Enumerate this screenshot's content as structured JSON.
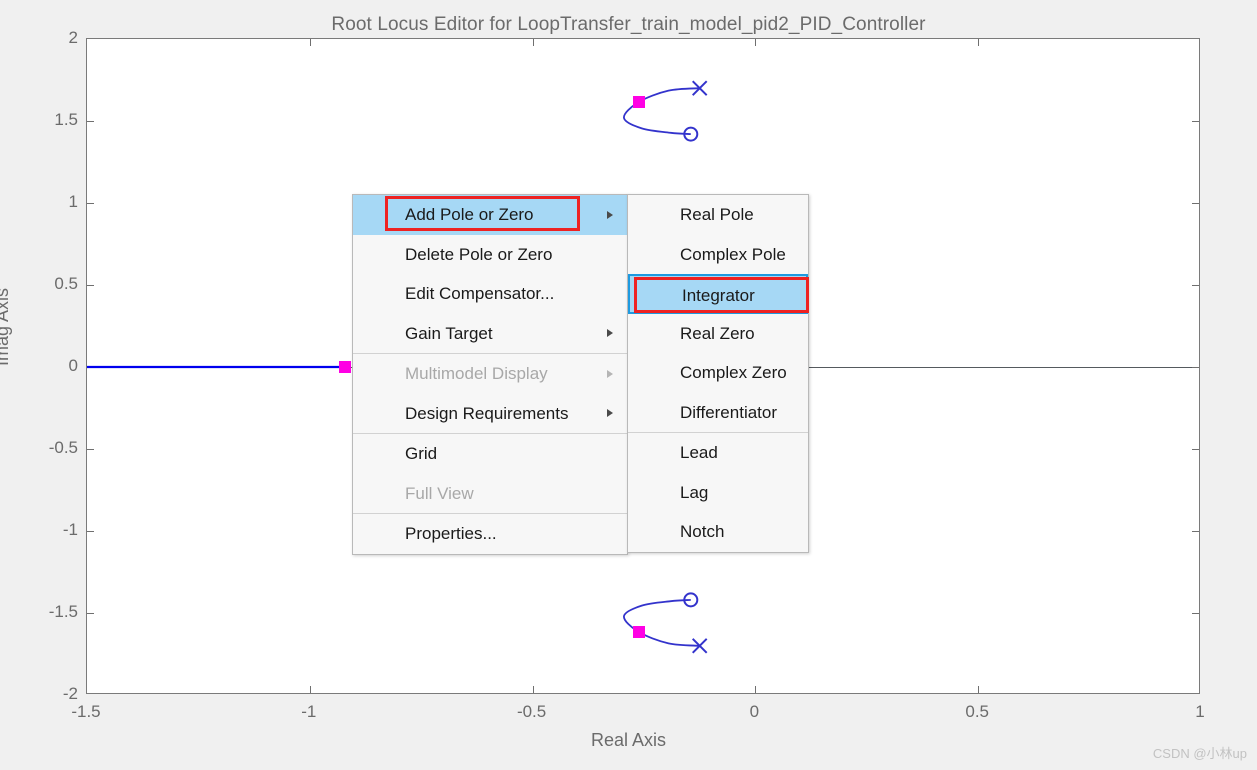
{
  "title": "Root Locus Editor for LoopTransfer_train_model_pid2_PID_Controller",
  "axes": {
    "xlabel": "Real Axis",
    "ylabel": "Imag Axis",
    "xticks": [
      "-1.5",
      "-1",
      "-0.5",
      "0",
      "0.5",
      "1"
    ],
    "yticks": [
      "2",
      "1.5",
      "1",
      "0.5",
      "0",
      "-0.5",
      "-1",
      "-1.5",
      "-2"
    ],
    "xlim": [
      -1.5,
      1
    ],
    "ylim": [
      -2,
      2
    ]
  },
  "chart_data": {
    "type": "scatter",
    "title": "Root Locus Editor for LoopTransfer_train_model_pid2_PID_Controller",
    "xlabel": "Real Axis",
    "ylabel": "Imag Axis",
    "xlim": [
      -1.5,
      1
    ],
    "ylim": [
      -2,
      2
    ],
    "grid": false,
    "legend": "none",
    "series": [
      {
        "name": "open-loop poles",
        "marker": "x",
        "color": "#3333cc",
        "points": [
          [
            -0.125,
            1.7
          ],
          [
            -0.125,
            -1.7
          ]
        ]
      },
      {
        "name": "open-loop zeros",
        "marker": "o",
        "color": "#3333cc",
        "points": [
          [
            -0.145,
            1.42
          ],
          [
            -0.145,
            -1.42
          ]
        ]
      },
      {
        "name": "closed-loop gain locations",
        "marker": "square",
        "color": "#ff00e4",
        "points": [
          [
            -0.262,
            1.615
          ],
          [
            -0.262,
            -1.615
          ],
          [
            -0.92,
            0.0
          ]
        ]
      },
      {
        "name": "locus branch upper",
        "marker": "line",
        "color": "#3333cc",
        "points": [
          [
            -0.125,
            1.7
          ],
          [
            -0.195,
            1.685
          ],
          [
            -0.262,
            1.615
          ],
          [
            -0.295,
            1.52
          ],
          [
            -0.255,
            1.455
          ],
          [
            -0.19,
            1.428
          ],
          [
            -0.145,
            1.42
          ]
        ]
      },
      {
        "name": "locus branch lower",
        "marker": "line",
        "color": "#3333cc",
        "points": [
          [
            -0.125,
            -1.7
          ],
          [
            -0.195,
            -1.685
          ],
          [
            -0.262,
            -1.615
          ],
          [
            -0.295,
            -1.52
          ],
          [
            -0.255,
            -1.455
          ],
          [
            -0.19,
            -1.428
          ],
          [
            -0.145,
            -1.42
          ]
        ]
      },
      {
        "name": "locus branch real axis",
        "marker": "line",
        "color": "#0000ee",
        "points": [
          [
            -1.5,
            0.0
          ],
          [
            -0.92,
            0.0
          ]
        ]
      }
    ]
  },
  "context_menu": {
    "items": [
      {
        "label": "Add Pole or Zero",
        "disabled": false,
        "submenu": true,
        "highlighted": true,
        "separator_before": false
      },
      {
        "label": "Delete Pole or Zero",
        "disabled": false,
        "submenu": false,
        "highlighted": false,
        "separator_before": false
      },
      {
        "label": "Edit Compensator...",
        "disabled": false,
        "submenu": false,
        "highlighted": false,
        "separator_before": false
      },
      {
        "label": "Gain Target",
        "disabled": false,
        "submenu": true,
        "highlighted": false,
        "separator_before": false
      },
      {
        "label": "Multimodel Display",
        "disabled": true,
        "submenu": true,
        "highlighted": false,
        "separator_before": true
      },
      {
        "label": "Design Requirements",
        "disabled": false,
        "submenu": true,
        "highlighted": false,
        "separator_before": false
      },
      {
        "label": "Grid",
        "disabled": false,
        "submenu": false,
        "highlighted": false,
        "separator_before": true
      },
      {
        "label": "Full View",
        "disabled": true,
        "submenu": false,
        "highlighted": false,
        "separator_before": false
      },
      {
        "label": "Properties...",
        "disabled": false,
        "submenu": false,
        "highlighted": false,
        "separator_before": true
      }
    ]
  },
  "submenu": {
    "items": [
      {
        "label": "Real Pole",
        "disabled": false,
        "highlighted": false,
        "separator_before": false
      },
      {
        "label": "Complex Pole",
        "disabled": false,
        "highlighted": false,
        "separator_before": false
      },
      {
        "label": "Integrator",
        "disabled": false,
        "highlighted": true,
        "separator_before": false
      },
      {
        "label": "Real Zero",
        "disabled": false,
        "highlighted": false,
        "separator_before": false
      },
      {
        "label": "Complex Zero",
        "disabled": false,
        "highlighted": false,
        "separator_before": false
      },
      {
        "label": "Differentiator",
        "disabled": false,
        "highlighted": false,
        "separator_before": false
      },
      {
        "label": "Lead",
        "disabled": false,
        "highlighted": false,
        "separator_before": true
      },
      {
        "label": "Lag",
        "disabled": false,
        "highlighted": false,
        "separator_before": false
      },
      {
        "label": "Notch",
        "disabled": false,
        "highlighted": false,
        "separator_before": false
      }
    ]
  },
  "annotations": [
    {
      "name": "add-pole-or-zero-annotation",
      "color": "#ee2222"
    },
    {
      "name": "integrator-annotation",
      "color": "#ee2222"
    }
  ],
  "watermark": "CSDN @小林up",
  "colors": {
    "locus": "#3333cc",
    "gain_marker": "#ff00e4",
    "highlight": "#a6d8f5",
    "highlight_border": "#1e9ae0",
    "annotation": "#ee2222",
    "figure_bg": "#f0f0f0",
    "axes_bg": "#ffffff"
  }
}
